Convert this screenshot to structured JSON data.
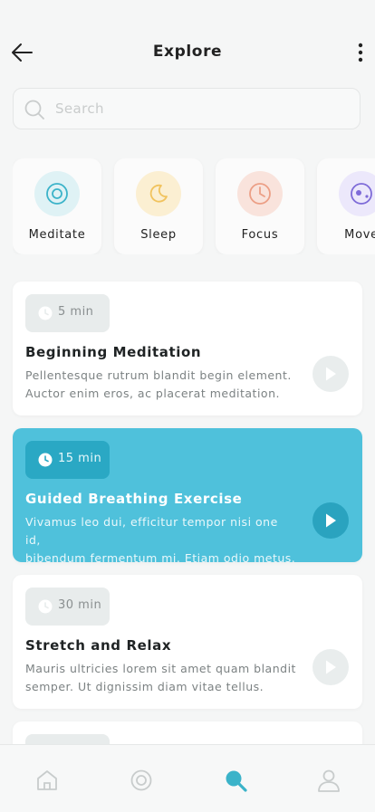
{
  "header": {
    "title": "Explore"
  },
  "search": {
    "placeholder": "Search"
  },
  "categories": [
    {
      "label": "Meditate",
      "icon": "target-icon",
      "color": "#3bb3c9",
      "bg": "#dff2f5"
    },
    {
      "label": "Sleep",
      "icon": "moon-icon",
      "color": "#f1c35e",
      "bg": "#fbefd2"
    },
    {
      "label": "Focus",
      "icon": "clock-icon",
      "color": "#ec9f86",
      "bg": "#f9e3dc"
    },
    {
      "label": "Move",
      "icon": "orbit-icon",
      "color": "#7e6bd8",
      "bg": "#ece8fb"
    }
  ],
  "sessions": [
    {
      "duration": "5 min",
      "title": "Beginning Meditation",
      "desc_line1": "Pellentesque rutrum blandit begin element.",
      "desc_line2": "Auctor enim eros, ac placerat meditation.",
      "active": false
    },
    {
      "duration": "15 min",
      "title": "Guided Breathing Exercise",
      "desc_line1": "Vivamus leo dui, efficitur tempor nisi one id,",
      "desc_line2": "bibendum fermentum mi. Etiam odio metus.",
      "active": true
    },
    {
      "duration": "30 min",
      "title": "Stretch and Relax",
      "desc_line1": "Mauris ultricies lorem sit amet quam blandit",
      "desc_line2": "semper. Ut dignissim diam vitae tellus.",
      "active": false
    }
  ],
  "nav": {
    "items": [
      "home-icon",
      "meditate-icon",
      "search-icon",
      "profile-icon"
    ],
    "active": "search-icon",
    "accent": "#3bb3c9"
  }
}
